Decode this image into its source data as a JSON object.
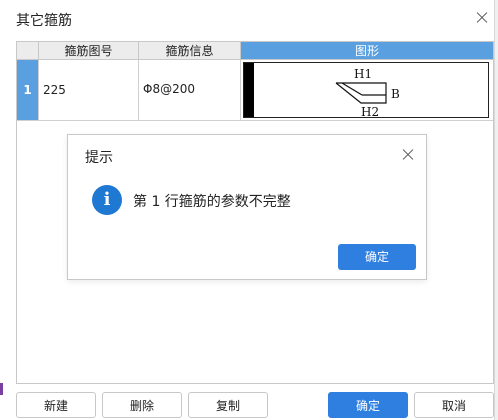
{
  "window": {
    "title": "其它箍筋"
  },
  "grid": {
    "headers": [
      "",
      "箍筋图号",
      "箍筋信息",
      "图形"
    ],
    "rows": [
      {
        "index": "1",
        "figure_no": "225",
        "info": "Φ8@200",
        "shape_labels": {
          "top": "H1",
          "right": "B",
          "bottom": "H2"
        }
      }
    ]
  },
  "dialog": {
    "title": "提示",
    "message": "第 1 行箍筋的参数不完整",
    "ok_label": "确定",
    "icon": "info-icon"
  },
  "buttons": {
    "new_label": "新建",
    "delete_label": "删除",
    "copy_label": "复制",
    "ok_label": "确定",
    "cancel_label": "取消"
  },
  "colors": {
    "accent": "#2f7fe0",
    "header_selected": "#5aa0e0"
  }
}
